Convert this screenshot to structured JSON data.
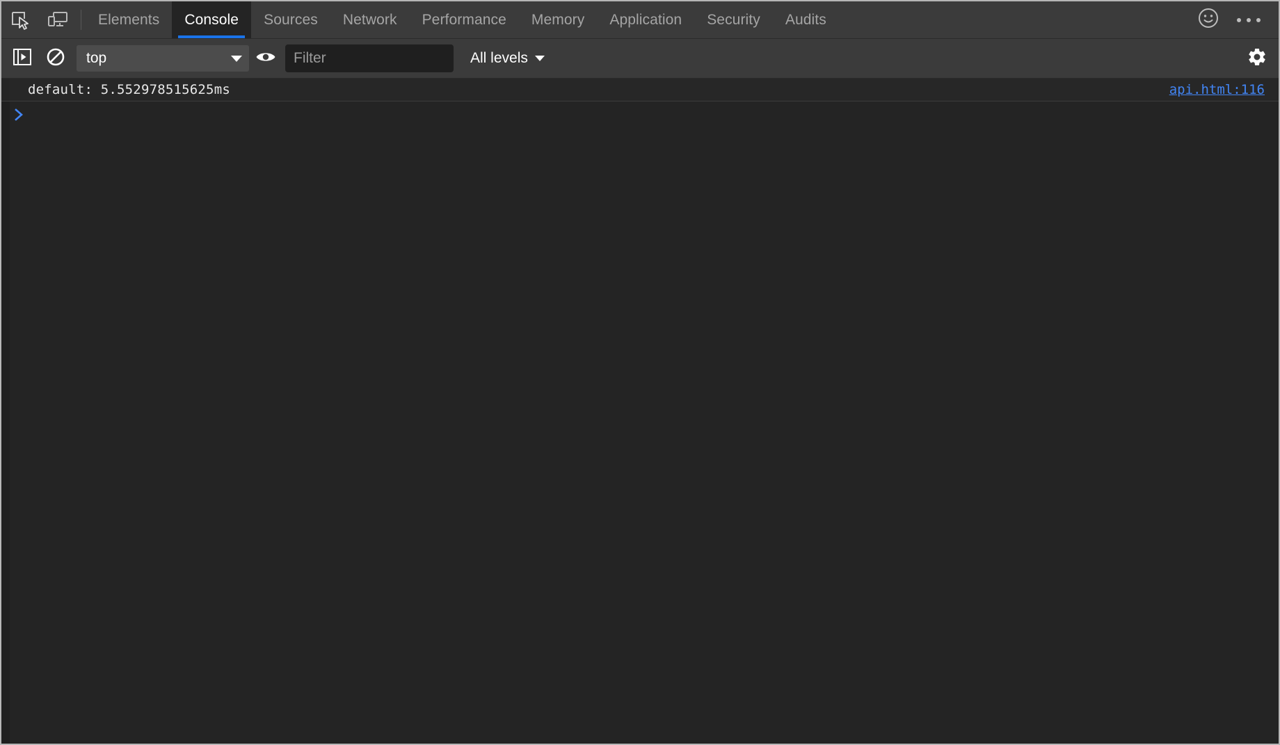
{
  "window": {
    "title": "DevTools - Console"
  },
  "colors": {
    "accent_blue": "#1a73e8",
    "link_blue": "#4285f4",
    "tabbar_bg": "#3b3b3b",
    "panel_bg": "#242424",
    "message_bg": "#272727",
    "text_primary": "#ffffff",
    "text_muted": "#a5a5a5"
  },
  "tabbar": {
    "inspect_icon": "inspect-element-icon",
    "device_icon": "device-toolbar-icon",
    "tabs": [
      {
        "label": "Elements",
        "active": false
      },
      {
        "label": "Console",
        "active": true
      },
      {
        "label": "Sources",
        "active": false
      },
      {
        "label": "Network",
        "active": false
      },
      {
        "label": "Performance",
        "active": false
      },
      {
        "label": "Memory",
        "active": false
      },
      {
        "label": "Application",
        "active": false
      },
      {
        "label": "Security",
        "active": false
      },
      {
        "label": "Audits",
        "active": false
      }
    ],
    "feedback_icon": "smiley-face-icon",
    "more_icon": "more-options-icon"
  },
  "toolbar": {
    "sidebar_toggle_icon": "console-sidebar-toggle-icon",
    "clear_icon": "clear-console-icon",
    "context": {
      "value": "top",
      "caret_icon": "chevron-down-icon"
    },
    "live_expression_icon": "eye-icon",
    "filter": {
      "value": "",
      "placeholder": "Filter"
    },
    "levels": {
      "label": "All levels",
      "caret_icon": "chevron-down-icon"
    },
    "settings_icon": "gear-icon"
  },
  "console": {
    "messages": [
      {
        "text": "default: 5.552978515625ms",
        "source": "api.html:116"
      }
    ],
    "prompt": {
      "chevron_icon": "prompt-chevron-icon",
      "value": ""
    }
  }
}
